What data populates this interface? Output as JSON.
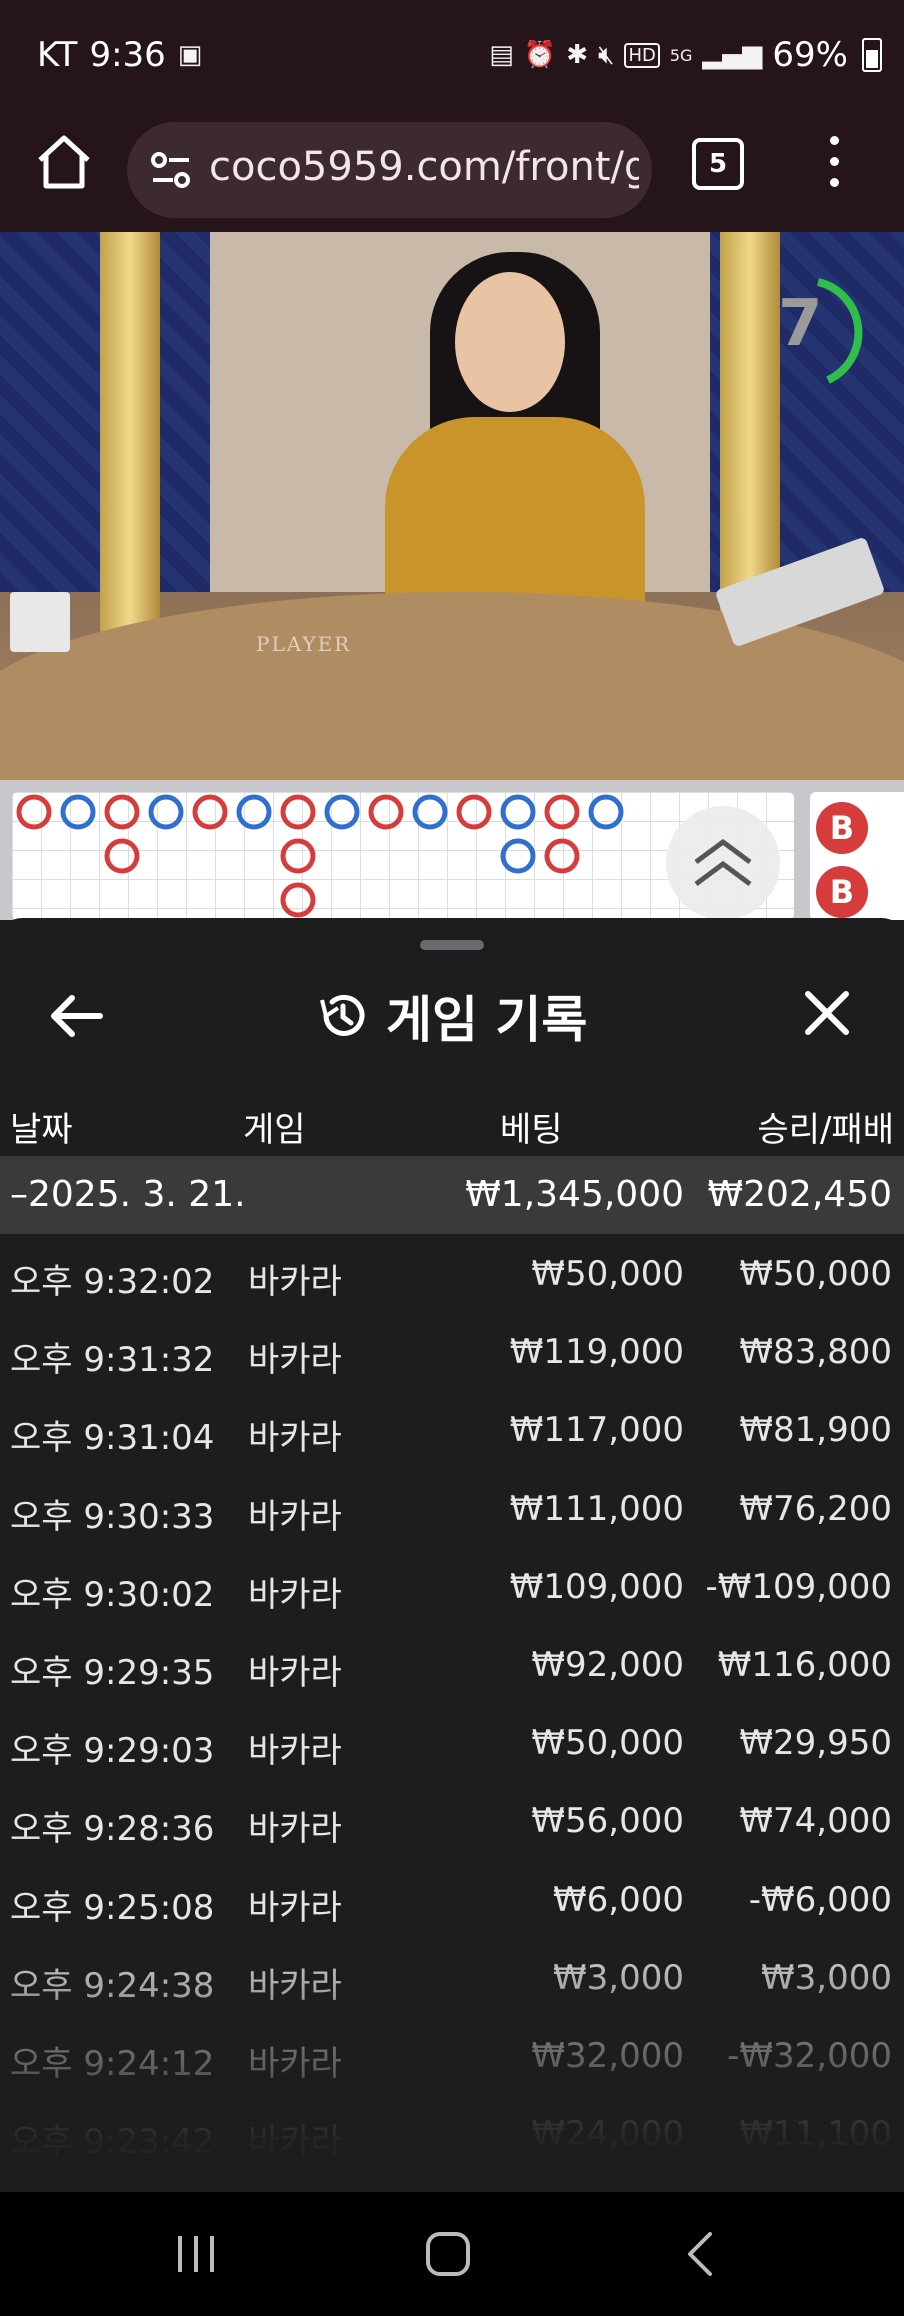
{
  "status_bar": {
    "carrier": "KT",
    "time": "9:36",
    "network": "5G",
    "battery": "69%"
  },
  "browser": {
    "url": "coco5959.com/front/g",
    "tab_count": "5"
  },
  "video": {
    "timer": "7",
    "table_label": "PLAYER"
  },
  "roadmap": {
    "badges": [
      "B",
      "B"
    ]
  },
  "history": {
    "title": "게임 기록",
    "headers": {
      "date": "날짜",
      "game": "게임",
      "bet": "베팅",
      "winloss": "승리/패배"
    },
    "summary": {
      "date": "–2025. 3. 21.",
      "bet": "₩1,345,000",
      "winloss": "₩202,450"
    },
    "rows": [
      {
        "time": "오후 9:32:02",
        "game": "바카라",
        "bet": "₩50,000",
        "winloss": "₩50,000"
      },
      {
        "time": "오후 9:31:32",
        "game": "바카라",
        "bet": "₩119,000",
        "winloss": "₩83,800"
      },
      {
        "time": "오후 9:31:04",
        "game": "바카라",
        "bet": "₩117,000",
        "winloss": "₩81,900"
      },
      {
        "time": "오후 9:30:33",
        "game": "바카라",
        "bet": "₩111,000",
        "winloss": "₩76,200"
      },
      {
        "time": "오후 9:30:02",
        "game": "바카라",
        "bet": "₩109,000",
        "winloss": "-₩109,000"
      },
      {
        "time": "오후 9:29:35",
        "game": "바카라",
        "bet": "₩92,000",
        "winloss": "₩116,000"
      },
      {
        "time": "오후 9:29:03",
        "game": "바카라",
        "bet": "₩50,000",
        "winloss": "₩29,950"
      },
      {
        "time": "오후 9:28:36",
        "game": "바카라",
        "bet": "₩56,000",
        "winloss": "₩74,000"
      },
      {
        "time": "오후 9:25:08",
        "game": "바카라",
        "bet": "₩6,000",
        "winloss": "-₩6,000"
      },
      {
        "time": "오후 9:24:38",
        "game": "바카라",
        "bet": "₩3,000",
        "winloss": "₩3,000"
      },
      {
        "time": "오후 9:24:12",
        "game": "바카라",
        "bet": "₩32,000",
        "winloss": "-₩32,000"
      },
      {
        "time": "오후 9:23:42",
        "game": "바카라",
        "bet": "₩24,000",
        "winloss": "₩11,100"
      }
    ]
  },
  "colors": {
    "player_blue": "#2f6fcf",
    "banker_red": "#d63c3c",
    "timer_green": "#2fbf4a"
  }
}
